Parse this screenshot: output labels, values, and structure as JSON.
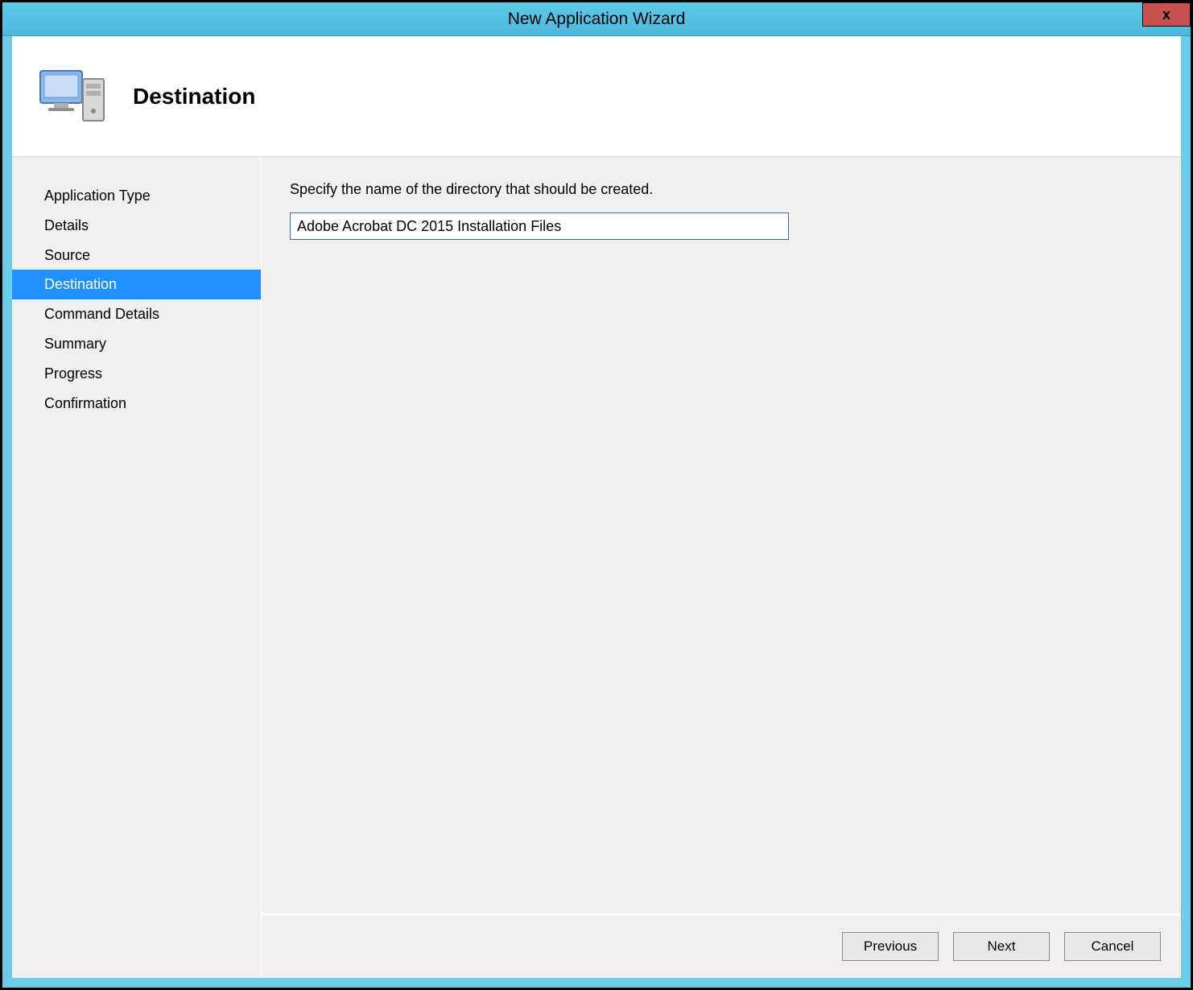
{
  "window": {
    "title": "New Application Wizard",
    "close_label": "x"
  },
  "header": {
    "title": "Destination"
  },
  "sidebar": {
    "items": [
      {
        "label": "Application Type",
        "selected": false
      },
      {
        "label": "Details",
        "selected": false
      },
      {
        "label": "Source",
        "selected": false
      },
      {
        "label": "Destination",
        "selected": true
      },
      {
        "label": "Command Details",
        "selected": false
      },
      {
        "label": "Summary",
        "selected": false
      },
      {
        "label": "Progress",
        "selected": false
      },
      {
        "label": "Confirmation",
        "selected": false
      }
    ]
  },
  "main": {
    "instruction": "Specify the name of the directory that should be created.",
    "directory_name": "Adobe Acrobat DC 2015 Installation Files"
  },
  "buttons": {
    "previous": "Previous",
    "next": "Next",
    "cancel": "Cancel"
  }
}
